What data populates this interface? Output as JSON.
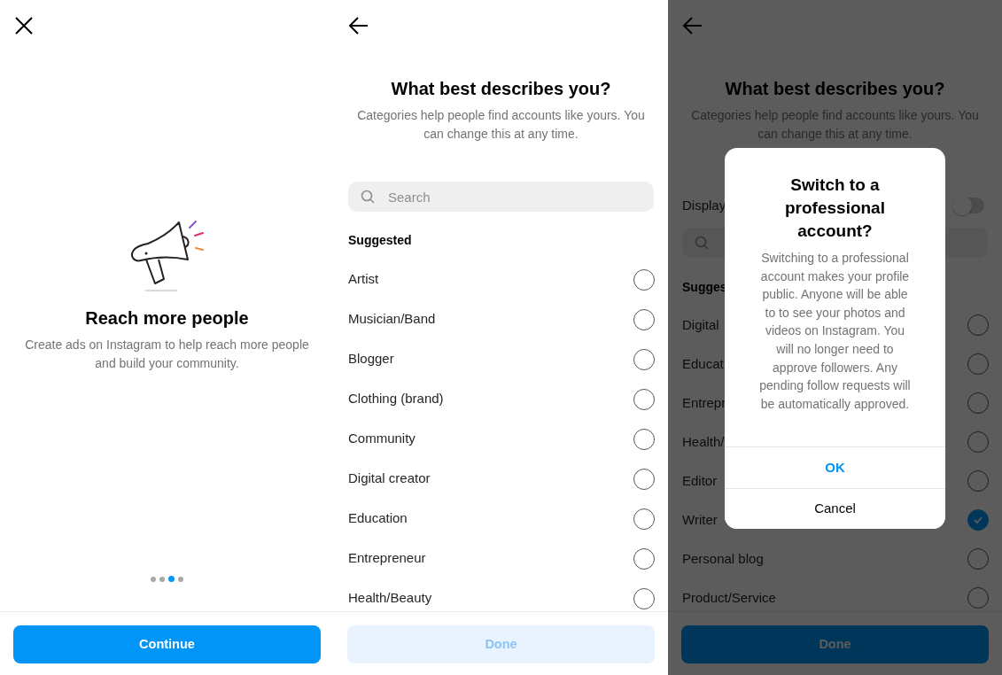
{
  "screens": [
    {
      "kind": "intro",
      "title": "Reach more people",
      "description": "Create ads on Instagram to help reach more people and build your community.",
      "pager": [
        {
          "selected": false
        },
        {
          "selected": false
        },
        {
          "selected": true
        },
        {
          "selected": false
        }
      ],
      "button": {
        "label": "Continue",
        "disabled": false
      }
    },
    {
      "kind": "categories",
      "title": "What best describes you?",
      "description": "Categories help people find accounts like yours. You can change this at any time.",
      "search": {
        "placeholder": "Search"
      },
      "section": "Suggested",
      "options": [
        {
          "label": "Artist",
          "selected": false
        },
        {
          "label": "Musician/Band",
          "selected": false
        },
        {
          "label": "Blogger",
          "selected": false
        },
        {
          "label": "Clothing (brand)",
          "selected": false
        },
        {
          "label": "Community",
          "selected": false
        },
        {
          "label": "Digital creator",
          "selected": false
        },
        {
          "label": "Education",
          "selected": false
        },
        {
          "label": "Entrepreneur",
          "selected": false
        },
        {
          "label": "Health/Beauty",
          "selected": false
        }
      ],
      "button": {
        "label": "Done",
        "disabled": true
      }
    },
    {
      "kind": "categories",
      "title": "What best describes you?",
      "description": "Categories help people find accounts like yours. You can change this at any time.",
      "display_toggle": {
        "label": "Display",
        "on": false
      },
      "section": "Sugges",
      "options": [
        {
          "label": "Digital",
          "selected": false
        },
        {
          "label": "Educat",
          "selected": false
        },
        {
          "label": "Entrepr",
          "selected": false
        },
        {
          "label": "Health/",
          "selected": false
        },
        {
          "label": "Editor",
          "selected": false
        },
        {
          "label": "Writer",
          "selected": true
        },
        {
          "label": "Personal blog",
          "selected": false
        },
        {
          "label": "Product/Service",
          "selected": false
        }
      ],
      "button": {
        "label": "Done",
        "disabled": false
      },
      "dialog": {
        "title": "Switch to a professional account?",
        "message": "Switching to a professional account makes your profile public. Anyone will be able to to see your photos and videos on Instagram. You will no longer need to approve followers. Any pending follow requests will be automatically approved.",
        "buttons": [
          {
            "label": "OK",
            "kind": "primary"
          },
          {
            "label": "Cancel",
            "kind": "default"
          }
        ]
      }
    }
  ]
}
